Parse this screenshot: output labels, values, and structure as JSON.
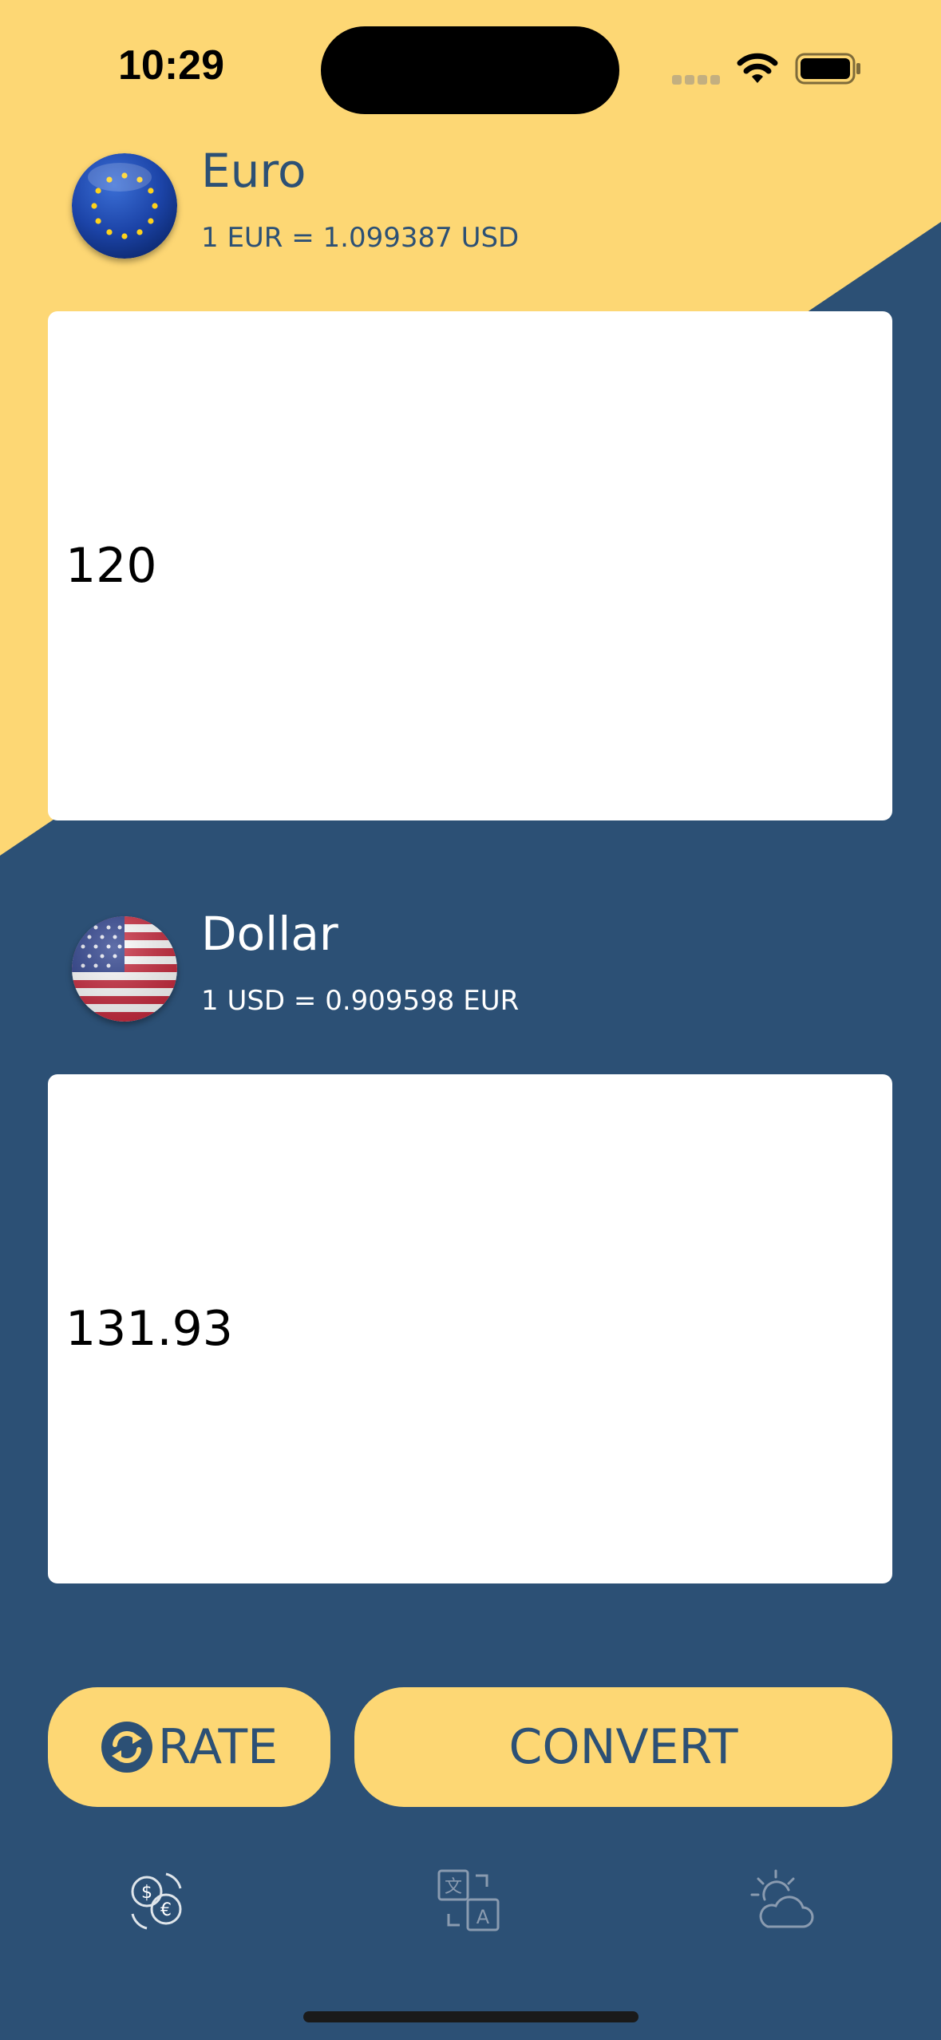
{
  "status_bar": {
    "time": "10:29"
  },
  "from_currency": {
    "name": "Euro",
    "rate_text": "1 EUR = 1.099387 USD",
    "amount": "120",
    "flag_icon": "eu-flag-icon"
  },
  "to_currency": {
    "name": "Dollar",
    "rate_text": "1 USD = 0.909598 EUR",
    "amount": "131.93",
    "flag_icon": "us-flag-icon"
  },
  "buttons": {
    "rate_label": "RATE",
    "convert_label": "CONVERT"
  },
  "tab_bar": {
    "tabs": [
      {
        "icon": "currency-exchange-icon",
        "active": true
      },
      {
        "icon": "translate-icon",
        "active": false
      },
      {
        "icon": "weather-icon",
        "active": false
      }
    ]
  },
  "colors": {
    "yellow": "#fdd774",
    "navy": "#2c5075",
    "white": "#ffffff"
  }
}
